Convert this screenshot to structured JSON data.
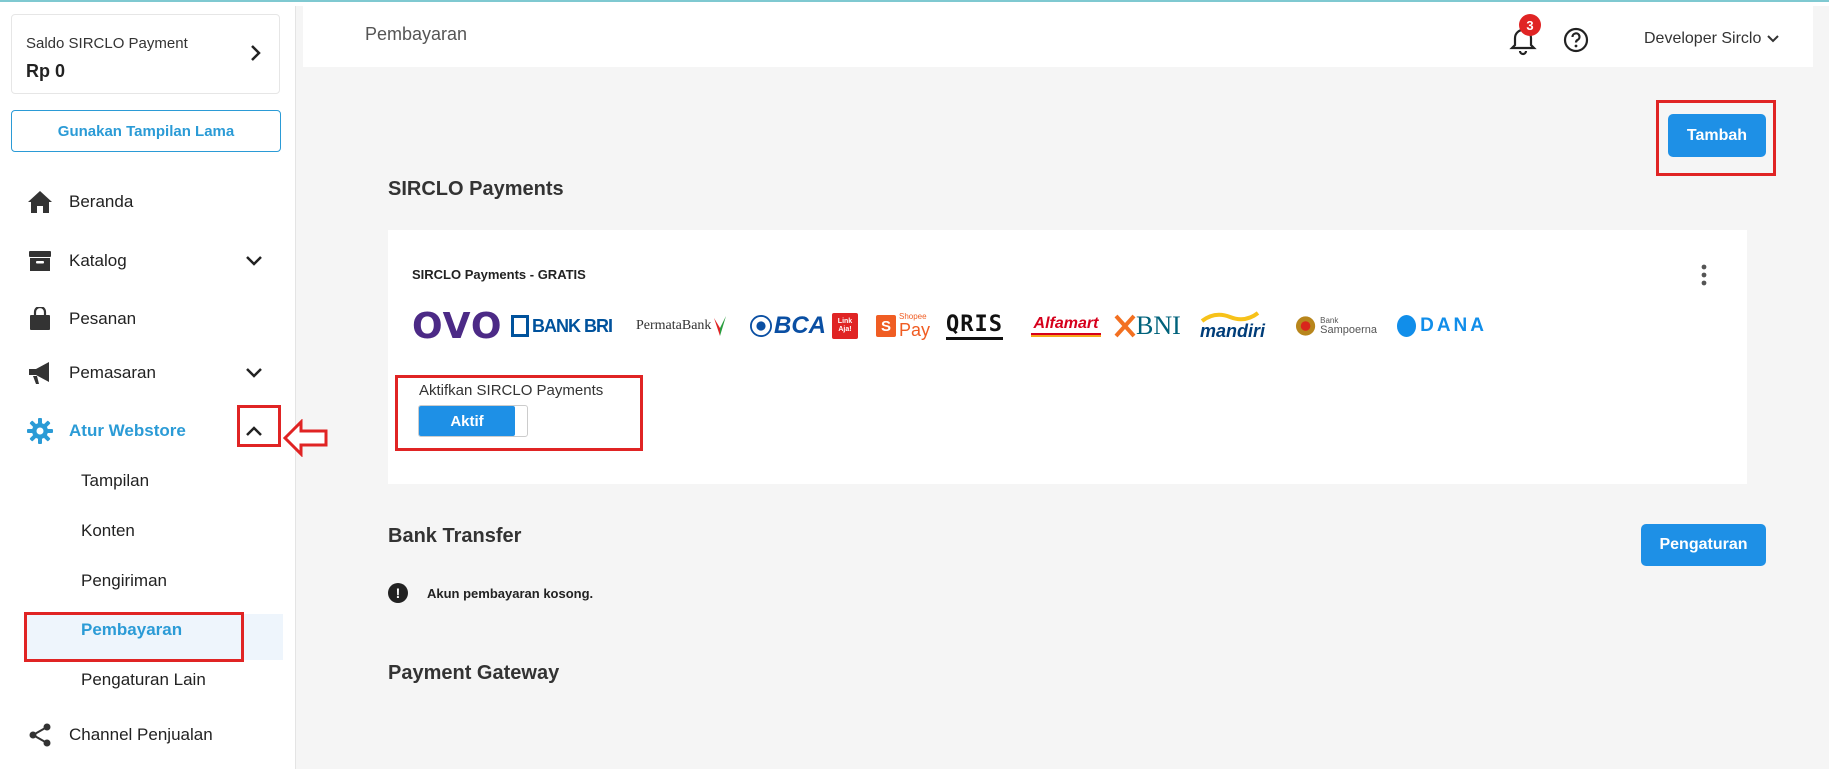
{
  "sidebar": {
    "saldo_label": "Saldo SIRCLO Payment",
    "saldo_value": "Rp 0",
    "old_view_button": "Gunakan Tampilan Lama",
    "nav": [
      {
        "label": "Beranda",
        "icon": "home-icon"
      },
      {
        "label": "Katalog",
        "icon": "box-icon",
        "expandable": true
      },
      {
        "label": "Pesanan",
        "icon": "bag-icon"
      },
      {
        "label": "Pemasaran",
        "icon": "megaphone-icon",
        "expandable": true
      },
      {
        "label": "Atur Webstore",
        "icon": "gear-icon",
        "expanded": true,
        "active": true
      },
      {
        "label": "Channel Penjualan",
        "icon": "share-icon"
      }
    ],
    "sub_items": [
      "Tampilan",
      "Konten",
      "Pengiriman",
      "Pembayaran",
      "Pengaturan Lain"
    ],
    "active_sub": "Pembayaran"
  },
  "header": {
    "title": "Pembayaran",
    "notification_count": "3",
    "user": "Developer Sirclo"
  },
  "main": {
    "add_button": "Tambah",
    "sircla_section_title": "SIRCLO Payments",
    "card_title": "SIRCLO Payments - GRATIS",
    "logos": {
      "ovo": "OVO",
      "bri": "BANK BRI",
      "permata": "PermataBank",
      "bca": "BCA",
      "linkaja": "Link Aja!",
      "shopeepay_small": "Shopee",
      "shopeepay": "Pay",
      "qris": "QRIS",
      "alfamart": "Alfamart",
      "bni": "BNI",
      "mandiri": "mandiri",
      "sampoerna_small": "Bank",
      "sampoerna": "Sampoerna",
      "dana": "DANA"
    },
    "toggle_label": "Aktifkan SIRCLO Payments",
    "toggle_value": "Aktif",
    "bank_transfer_title": "Bank Transfer",
    "settings_button": "Pengaturan",
    "empty_message": "Akun pembayaran kosong.",
    "payment_gateway_title": "Payment Gateway"
  },
  "colors": {
    "accent": "#1e90e6",
    "highlight": "#e02424"
  }
}
